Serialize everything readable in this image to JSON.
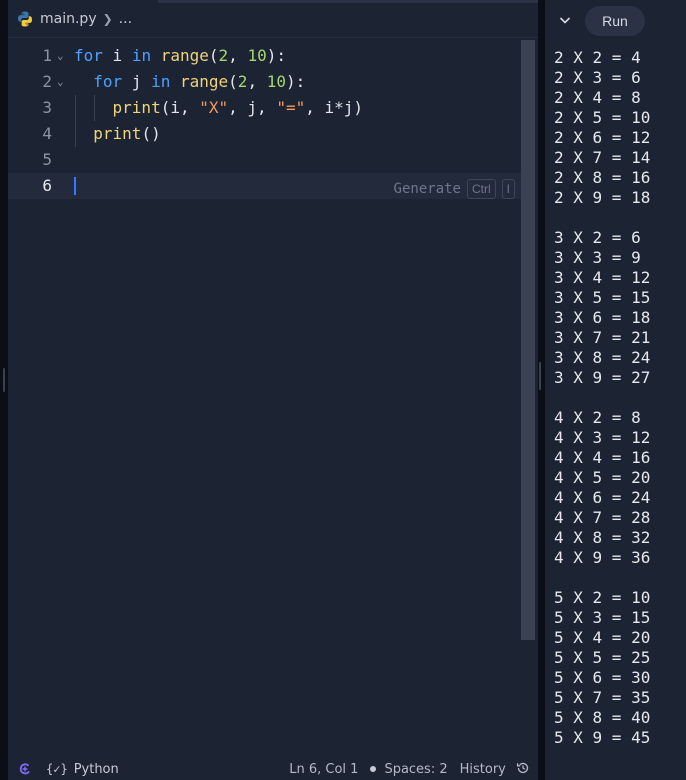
{
  "editor": {
    "breadcrumb": {
      "file": "main.py",
      "ellipsis": "..."
    },
    "lines": [
      {
        "n": "1",
        "fold": "⌄",
        "tokens": [
          [
            "kw",
            "for"
          ],
          [
            "pl",
            " i "
          ],
          [
            "kw",
            "in"
          ],
          [
            "pl",
            " "
          ],
          [
            "fn",
            "range"
          ],
          [
            "pl",
            "("
          ],
          [
            "num",
            "2"
          ],
          [
            "pl",
            ", "
          ],
          [
            "num",
            "10"
          ],
          [
            "pl",
            "):"
          ]
        ]
      },
      {
        "n": "2",
        "fold": "⌄",
        "tokens": [
          [
            "pl",
            "  "
          ],
          [
            "kw",
            "for"
          ],
          [
            "pl",
            " j "
          ],
          [
            "kw",
            "in"
          ],
          [
            "pl",
            " "
          ],
          [
            "fn",
            "range"
          ],
          [
            "pl",
            "("
          ],
          [
            "num",
            "2"
          ],
          [
            "pl",
            ", "
          ],
          [
            "num",
            "10"
          ],
          [
            "pl",
            "):"
          ]
        ]
      },
      {
        "n": "3",
        "fold": "",
        "tokens": [
          [
            "pl",
            "    "
          ],
          [
            "fn",
            "print"
          ],
          [
            "pl",
            "(i, "
          ],
          [
            "str",
            "\"X\""
          ],
          [
            "pl",
            ", j, "
          ],
          [
            "str",
            "\"=\""
          ],
          [
            "pl",
            ", i*j)"
          ]
        ]
      },
      {
        "n": "4",
        "fold": "",
        "tokens": [
          [
            "pl",
            "  "
          ],
          [
            "fn",
            "print"
          ],
          [
            "pl",
            "()"
          ]
        ]
      },
      {
        "n": "5",
        "fold": "",
        "tokens": []
      },
      {
        "n": "6",
        "fold": "",
        "tokens": []
      }
    ],
    "generate_hint": {
      "label": "Generate",
      "key1": "Ctrl",
      "key2": "I"
    }
  },
  "statusbar": {
    "language": "Python",
    "position": "Ln 6, Col 1",
    "spaces": "Spaces: 2",
    "history": "History"
  },
  "console": {
    "run_label": "Run",
    "output": "2 X 2 = 4\n2 X 3 = 6\n2 X 4 = 8\n2 X 5 = 10\n2 X 6 = 12\n2 X 7 = 14\n2 X 8 = 16\n2 X 9 = 18\n\n3 X 2 = 6\n3 X 3 = 9\n3 X 4 = 12\n3 X 5 = 15\n3 X 6 = 18\n3 X 7 = 21\n3 X 8 = 24\n3 X 9 = 27\n\n4 X 2 = 8\n4 X 3 = 12\n4 X 4 = 16\n4 X 5 = 20\n4 X 6 = 24\n4 X 7 = 28\n4 X 8 = 32\n4 X 9 = 36\n\n5 X 2 = 10\n5 X 3 = 15\n5 X 4 = 20\n5 X 5 = 25\n5 X 6 = 30\n5 X 7 = 35\n5 X 8 = 40\n5 X 9 = 45"
  },
  "colors": {
    "background": "#1c2333",
    "keyword": "#4ea1ff",
    "function": "#f2d27a",
    "number": "#a5d66f",
    "string": "#f79a5a",
    "cursor": "#2f7bff"
  }
}
